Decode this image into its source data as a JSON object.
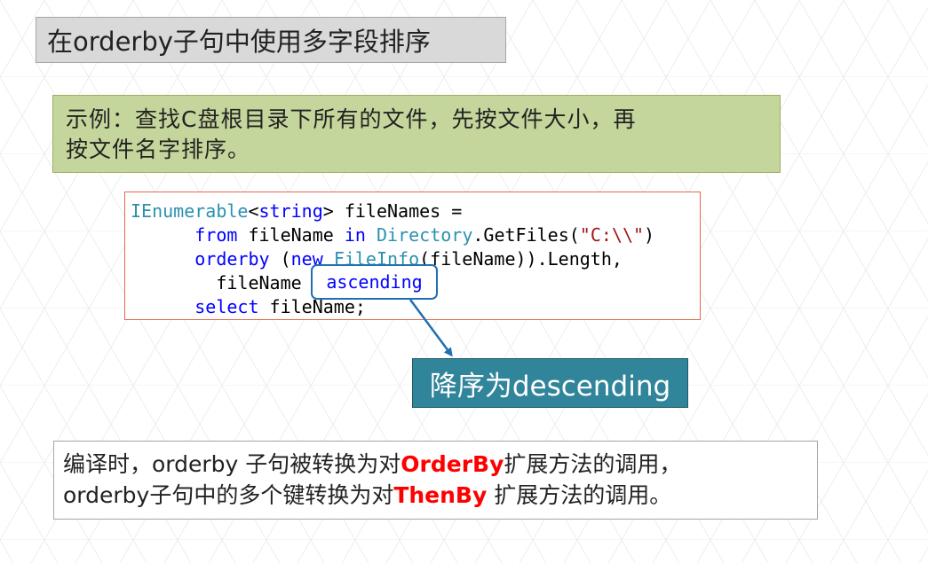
{
  "slide": {
    "title": "在orderby子句中使用多字段排序",
    "example": {
      "line1": "示例：查找C盘根目录下所有的文件，先按文件大小，再",
      "line2": "按文件名字排序。"
    },
    "code": {
      "l1_type": "IEnumerable",
      "l1_lt": "<",
      "l1_kw": "string",
      "l1_rest": "> fileNames =",
      "l2_kw_from": "from",
      "l2_mid": " fileName ",
      "l2_kw_in": "in",
      "l2_type": "Directory",
      "l2_call": ".GetFiles(",
      "l2_str": "\"C:\\\\\"",
      "l2_end": ")",
      "l3_kw_orderby": "orderby",
      "l3_open": " (",
      "l3_kw_new": "new",
      "l3_type": "FileInfo",
      "l3_rest": "(fileName)).Length,",
      "l4_text": "fileName",
      "l5_kw_select": "select",
      "l5_rest": " fileName;"
    },
    "highlight": "ascending",
    "callout": "降序为descending",
    "note": {
      "line1_a": "编译时，orderby 子句被转换为对",
      "line1_em": "OrderBy",
      "line1_b": "扩展方法的调用，",
      "line2_a": "orderby子句中的多个键转换为对",
      "line2_em": "ThenBy",
      "line2_b": " 扩展方法的调用。"
    },
    "colors": {
      "title_bg": "#d9d9d9",
      "example_bg": "#c4d69b",
      "code_border": "#e06a4b",
      "callout_bg": "#31859b",
      "highlight_border": "#1f6fb3",
      "emphasis": "#ff0000",
      "keyword": "#0000ff",
      "type": "#2b91af",
      "string": "#a31515"
    }
  }
}
